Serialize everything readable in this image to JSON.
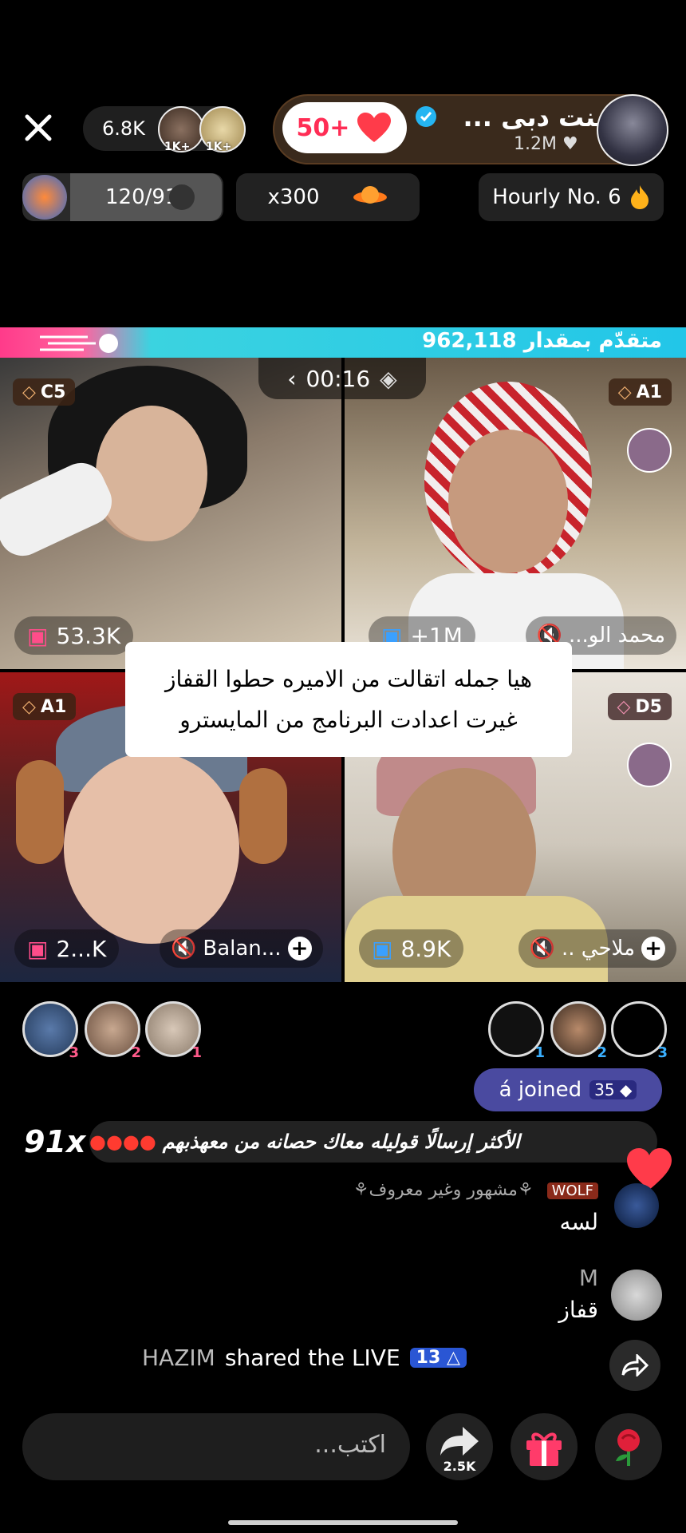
{
  "top_bar": {
    "viewer_count": "6.8K",
    "top_viewer_1_tag": "1K+",
    "top_viewer_2_tag": "1K+",
    "host_name": "بنت دبى ...",
    "host_likes": "1.2M",
    "like_pill": "50+"
  },
  "stats": {
    "rank": "120/91",
    "multiplier": "x300",
    "hourly": "Hourly No. 6"
  },
  "progress_text": "متقدّم بمقدار 962,118",
  "timer": "00:16",
  "tiles": [
    {
      "badge": "C5",
      "count": "53.3K",
      "name": ""
    },
    {
      "badge": "A1",
      "count": "+1M",
      "name": "محمد الو..."
    },
    {
      "badge": "A1",
      "count": "2...K",
      "name": "Balan..."
    },
    {
      "badge": "D5",
      "count": "8.9K",
      "name": "ملاحي .."
    }
  ],
  "caption": {
    "line1": "هيا جمله اتقالت من الاميره حطوا القفاز",
    "line2": "غيرت اعدادت البرنامج من المايسترو"
  },
  "gifters_left": [
    "3",
    "2",
    "1"
  ],
  "gifters_right": [
    "1",
    "2",
    "3"
  ],
  "joined": {
    "text": "á joined",
    "level": "35"
  },
  "top_message": {
    "text": "الأكثر إرسالًا قوليله معاك حصانه من معهذبهم",
    "multiplier": "91x"
  },
  "comments": [
    {
      "name": "⚘مشهور وغير معروف⚘",
      "badge": "WOLF",
      "text": "لسه"
    },
    {
      "name": "M",
      "text": "قفاز"
    }
  ],
  "share_event": {
    "user": "HAZIM",
    "action": "shared the LIVE",
    "level": "13"
  },
  "bottom": {
    "placeholder": "اكتب...",
    "share_count": "2.5K"
  },
  "colors": {
    "accent": "#ff2d55",
    "progress_blue": "#22c6e8",
    "progress_pink": "#ff3b8a"
  }
}
